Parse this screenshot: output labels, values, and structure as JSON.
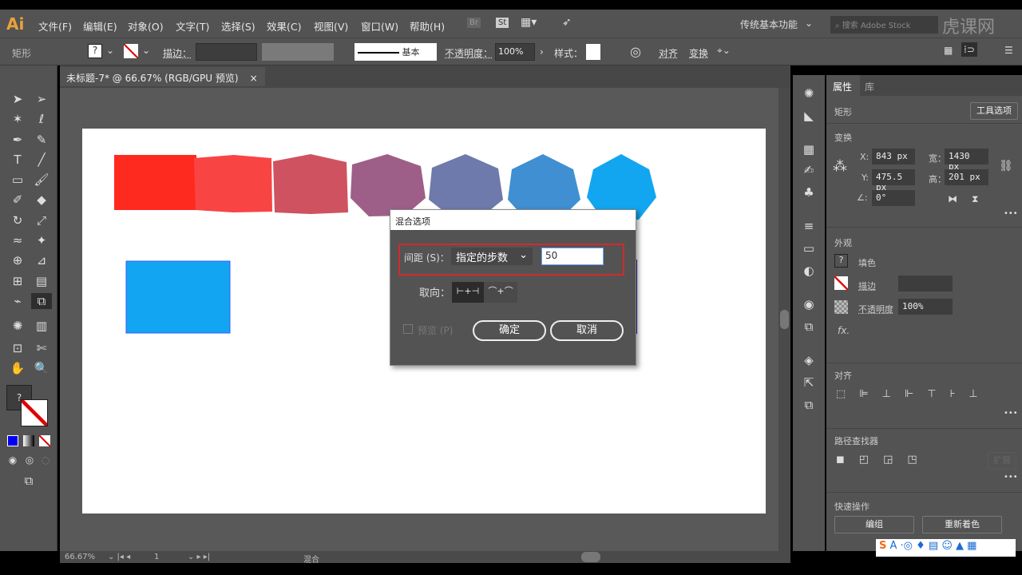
{
  "app": {
    "logo": "Ai",
    "workspace": "传统基本功能",
    "search_placeholder": "搜索 Adobe Stock",
    "bridge": "Br",
    "stock": "St",
    "watermark": "虎课网"
  },
  "menu": [
    "文件(F)",
    "编辑(E)",
    "对象(O)",
    "文字(T)",
    "选择(S)",
    "效果(C)",
    "视图(V)",
    "窗口(W)",
    "帮助(H)"
  ],
  "control": {
    "object_type": "矩形",
    "stroke_label": "描边：",
    "brush": "基本",
    "opacity_label": "不透明度：",
    "opacity": "100%",
    "style_label": "样式：",
    "align": "对齐",
    "transform": "变换"
  },
  "document_tab": {
    "title": "未标题-7* @ 66.67% (RGB/GPU 预览)",
    "close": "×"
  },
  "canvas": {
    "colors": [
      "#ff2a1f",
      "#f94444",
      "#cf5260",
      "#9d5f87",
      "#6e7aab",
      "#3f8fd2",
      "#12a6f0"
    ],
    "rect_color": "#12a5f2"
  },
  "dialog": {
    "title": "混合选项",
    "spacing_label": "间距 (S)：",
    "spacing_value": "指定的步数",
    "steps": "50",
    "orientation_label": "取向：",
    "preview": "预览 (P)",
    "ok": "确定",
    "cancel": "取消",
    "highlight_color": "#d42a2a"
  },
  "panel": {
    "tabs": [
      "属性",
      "库"
    ],
    "object": "矩形",
    "tool_options": "工具选项",
    "transform": "变换",
    "x_label": "X:",
    "x": "843 px",
    "y_label": "Y:",
    "y": "475.5 px",
    "w_label": "宽：",
    "w": "1430 px",
    "h_label": "高：",
    "h": "201 px",
    "angle": "0°",
    "appearance": "外观",
    "fill": "填色",
    "stroke": "描边",
    "opacity_label": "不透明度",
    "opacity": "100%",
    "fx": "fx.",
    "align": "对齐",
    "pathfinder": "路径查找器",
    "expand": "扩展",
    "quick_actions": "快速操作",
    "group": "编组",
    "recolor": "重新着色",
    "more": "•••"
  },
  "status": {
    "zoom": "66.67%",
    "page": "1",
    "tool": "混合"
  }
}
